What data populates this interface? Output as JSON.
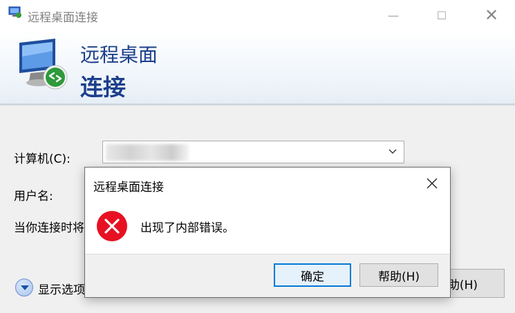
{
  "window": {
    "title": "远程桌面连接",
    "controls": {
      "minimize": "—",
      "maximize": "☐",
      "close": "✕"
    }
  },
  "banner": {
    "line1": "远程桌面",
    "line2": "连接"
  },
  "form": {
    "computer_label": "计算机(C):",
    "user_label": "用户名:",
    "hint_label": "当你连接时将"
  },
  "options": {
    "label": "显示选项"
  },
  "help_button_behind": "助(H)",
  "dialog": {
    "title": "远程桌面连接",
    "message": "出现了内部错误。",
    "ok_label": "确定",
    "help_label": "帮助(H)"
  },
  "colors": {
    "accent": "#0078d7",
    "banner_text": "#1b3f8b",
    "error_red": "#e81123"
  },
  "icons": {
    "app": "remote-desktop-icon",
    "hero": "remote-desktop-monitor-icon",
    "error": "error-x-icon",
    "options": "chevron-down-circle-icon"
  }
}
